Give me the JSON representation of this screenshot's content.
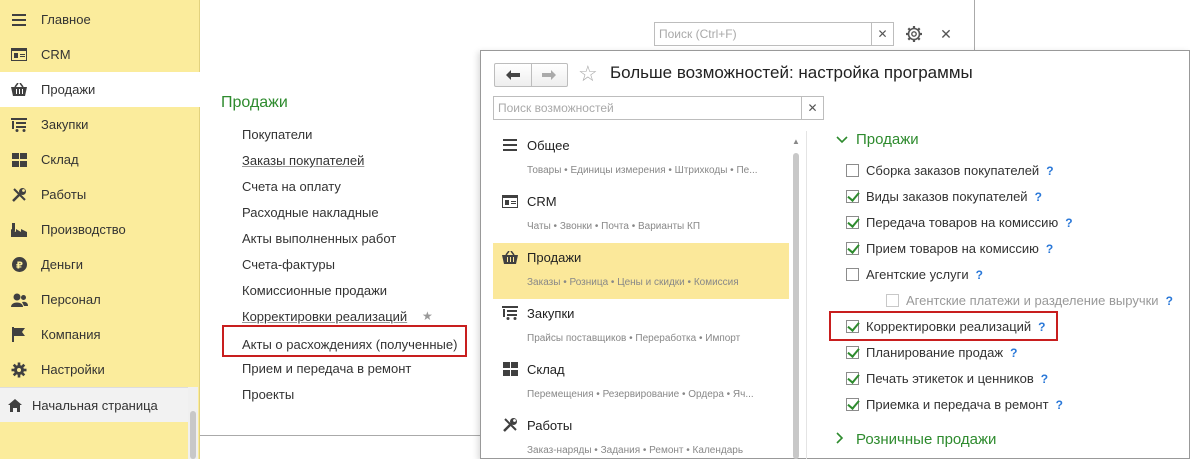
{
  "sidebar": {
    "items": [
      {
        "label": "Главное",
        "icon": "menu-icon"
      },
      {
        "label": "CRM",
        "icon": "crm-icon"
      },
      {
        "label": "Продажи",
        "icon": "basket-icon",
        "active": true
      },
      {
        "label": "Закупки",
        "icon": "purchases-icon"
      },
      {
        "label": "Склад",
        "icon": "warehouse-icon"
      },
      {
        "label": "Работы",
        "icon": "tools-icon"
      },
      {
        "label": "Производство",
        "icon": "factory-icon"
      },
      {
        "label": "Деньги",
        "icon": "money-icon"
      },
      {
        "label": "Персонал",
        "icon": "people-icon"
      },
      {
        "label": "Компания",
        "icon": "flag-icon"
      },
      {
        "label": "Настройки",
        "icon": "settings-icon"
      }
    ],
    "home_label": "Начальная страница"
  },
  "bg_window": {
    "search_placeholder": "Поиск (Ctrl+F)",
    "section_title": "Продажи",
    "links": [
      "Покупатели",
      "Заказы покупателей",
      "Счета на оплату",
      "Расходные накладные",
      "Акты выполненных работ",
      "Счета-фактуры",
      "Комиссионные продажи",
      "Корректировки реализаций",
      "Акты о расхождениях (полученные)",
      "Прием и передача в ремонт",
      "Проекты"
    ]
  },
  "fg_window": {
    "title": "Больше возможностей: настройка программы",
    "search_placeholder": "Поиск возможностей",
    "categories": [
      {
        "name": "Общее",
        "sub": "Товары • Единицы измерения • Штрихкоды • Пе...",
        "icon": "menu-icon"
      },
      {
        "name": "CRM",
        "sub": "Чаты • Звонки • Почта • Варианты КП",
        "icon": "crm-icon"
      },
      {
        "name": "Продажи",
        "sub": "Заказы • Розница • Цены и скидки • Комиссия",
        "icon": "basket-icon",
        "active": true
      },
      {
        "name": "Закупки",
        "sub": "Прайсы поставщиков • Переработка • Импорт",
        "icon": "purchases-icon"
      },
      {
        "name": "Склад",
        "sub": "Перемещения • Резервирование • Ордера • Яч...",
        "icon": "warehouse-icon"
      },
      {
        "name": "Работы",
        "sub": "Заказ-наряды • Задания • Ремонт • Календарь",
        "icon": "tools-icon"
      }
    ],
    "group_title": "Продажи",
    "options": [
      {
        "label": "Сборка заказов покупателей",
        "checked": false
      },
      {
        "label": "Виды заказов покупателей",
        "checked": true
      },
      {
        "label": "Передача товаров на комиссию",
        "checked": true
      },
      {
        "label": "Прием товаров на комиссию",
        "checked": true
      },
      {
        "label": "Агентские услуги",
        "checked": false
      },
      {
        "label": "Агентские платежи и разделение выручки",
        "checked": false,
        "disabled": true
      },
      {
        "label": "Корректировки реализаций",
        "checked": true,
        "highlighted": true
      },
      {
        "label": "Планирование продаж",
        "checked": true
      },
      {
        "label": "Печать этикеток и ценников",
        "checked": true
      },
      {
        "label": "Приемка и передача в ремонт",
        "checked": true
      }
    ],
    "help_mark": "?",
    "next_group_title": "Розничные продажи"
  },
  "colors": {
    "sidebar_bg": "#fbec9c",
    "accent_green": "#2e8b2e",
    "highlight_red": "#c81e1e",
    "help_blue": "#2a78d8"
  }
}
